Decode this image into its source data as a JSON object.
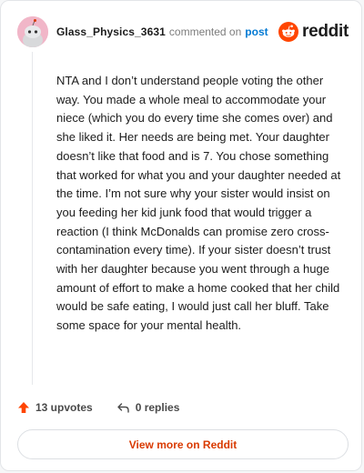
{
  "header": {
    "username": "Glass_Physics_3631",
    "commented_text": "commented on",
    "post_link": "post",
    "brand_name": "reddit"
  },
  "comment": {
    "body": "NTA and I don’t understand people voting the other way. You made a whole meal to accommodate your niece (which you do every time she comes over) and she liked it. Her needs are being met. Your daughter doesn’t like that food and is 7. You chose something that worked for what you and your daughter needed at the time. I’m not sure why your sister would insist on you feeding her kid junk food that would trigger a reaction (I think McDonalds can promise zero cross-contamination every time). If your sister doesn’t trust with her daughter because you went through a huge amount of effort to make a home cooked that her child would be safe eating, I would just call her bluff. Take some space for your mental health."
  },
  "actions": {
    "upvotes_label": "13 upvotes",
    "replies_label": "0 replies"
  },
  "footer": {
    "view_more_label": "View more on Reddit"
  },
  "colors": {
    "accent": "#ff4500",
    "link": "#0079d3",
    "cta_text": "#d93a00",
    "avatar_bg": "#f1b6c8"
  },
  "icons": [
    "avatar-snoo-icon",
    "reddit-logo-icon",
    "upvote-arrow-icon",
    "reply-arrow-icon"
  ]
}
